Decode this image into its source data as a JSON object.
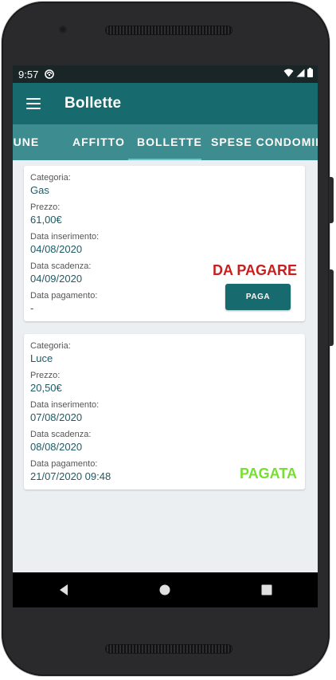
{
  "status_bar": {
    "time": "9:57"
  },
  "app_bar": {
    "title": "Bollette"
  },
  "tabs": [
    {
      "label": "COMUNE",
      "active": false
    },
    {
      "label": "AFFITTO",
      "active": false
    },
    {
      "label": "BOLLETTE",
      "active": true
    },
    {
      "label": "SPESE CONDOMINIALI",
      "active": false
    }
  ],
  "bills": [
    {
      "category_label": "Categoria:",
      "category": "Gas",
      "price_label": "Prezzo:",
      "price": "61,00€",
      "inserted_label": "Data inserimento:",
      "inserted": "04/08/2020",
      "due_label": "Data scadenza:",
      "due": "04/09/2020",
      "paid_label": "Data pagamento:",
      "paid": "-",
      "status": "DA PAGARE",
      "action_label": "PAGA"
    },
    {
      "category_label": "Categoria:",
      "category": "Luce",
      "price_label": "Prezzo:",
      "price": "20,50€",
      "inserted_label": "Data inserimento:",
      "inserted": "07/08/2020",
      "due_label": "Data scadenza:",
      "due": "08/08/2020",
      "paid_label": "Data pagamento:",
      "paid": "21/07/2020 09:48",
      "status": "PAGATA"
    }
  ],
  "colors": {
    "primary": "#176a6d",
    "tab_bar": "#3d8c8f",
    "unpaid": "#c62020",
    "paid": "#76e02f",
    "value_text": "#1d5b66"
  },
  "icons": {
    "menu": "menu-icon",
    "back": "back-icon",
    "home": "home-icon",
    "recents": "recents-icon",
    "wifi": "wifi-icon",
    "signal": "signal-icon",
    "battery": "battery-icon"
  }
}
